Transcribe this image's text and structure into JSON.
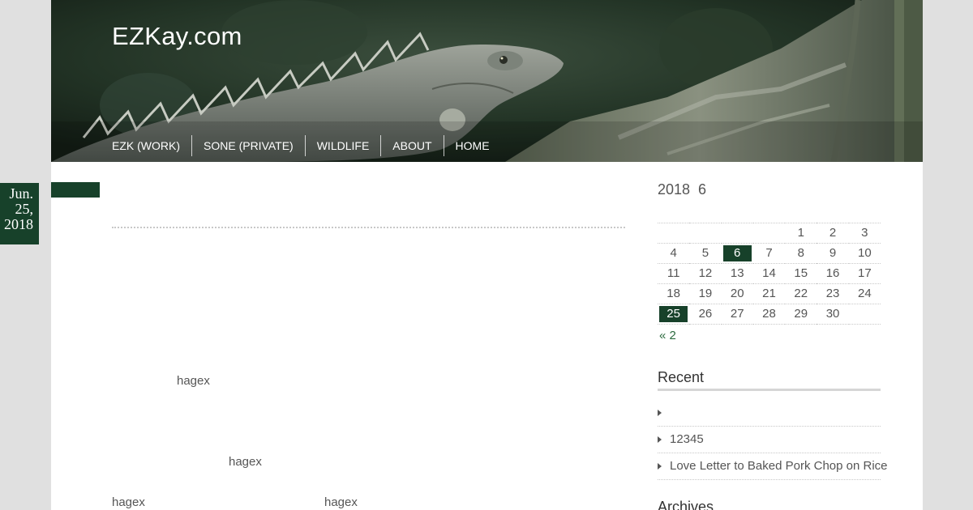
{
  "site": {
    "title": "EZKay.com"
  },
  "nav": {
    "items": [
      {
        "label": "EZK (WORK)"
      },
      {
        "label": "SONE (PRIVATE)"
      },
      {
        "label": "WILDLIFE"
      },
      {
        "label": "ABOUT"
      },
      {
        "label": "HOME"
      }
    ]
  },
  "post": {
    "date_month": "Jun.",
    "date_day": "25,",
    "date_year": "2018",
    "snippets": [
      "hagex",
      "hagex",
      "hagex",
      "hagex"
    ]
  },
  "calendar": {
    "caption": "2018  6",
    "rows": [
      [
        "",
        "",
        "",
        "",
        "1",
        "2",
        "3"
      ],
      [
        "4",
        "5",
        "6",
        "7",
        "8",
        "9",
        "10"
      ],
      [
        "11",
        "12",
        "13",
        "14",
        "15",
        "16",
        "17"
      ],
      [
        "18",
        "19",
        "20",
        "21",
        "22",
        "23",
        "24"
      ],
      [
        "25",
        "26",
        "27",
        "28",
        "29",
        "30",
        ""
      ]
    ],
    "highlighted": [
      "6",
      "25"
    ],
    "prev_link": "« 2"
  },
  "recent": {
    "title": "Recent",
    "items": [
      {
        "label": ""
      },
      {
        "label": "12345"
      },
      {
        "label": "Love Letter to Baked Pork Chop on Rice"
      }
    ]
  },
  "archives": {
    "title": "Archives"
  },
  "colors": {
    "accent_green": "#17412a",
    "link_green": "#2b6a3e",
    "page_bg": "#e0e0e0"
  }
}
